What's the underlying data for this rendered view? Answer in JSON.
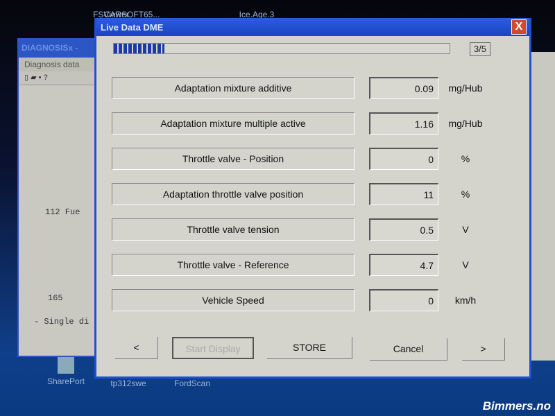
{
  "desktop": {
    "icons": [
      "FSViewer",
      "CARSOFT65...",
      "Ice.Age.3",
      "SharePort",
      "tp312swe",
      "FordScan"
    ]
  },
  "background_window": {
    "title": "DIAGNOSISx -",
    "menu": "Diagnosis data",
    "lines": [
      "112  Fue",
      "165",
      "- Single di"
    ]
  },
  "dialog": {
    "title": "Live Data DME",
    "close": "X",
    "progress_percent": 15,
    "page": "3/5",
    "rows": [
      {
        "label": "Adaptation mixture additive",
        "value": "0.09",
        "unit": "mg/Hub"
      },
      {
        "label": "Adaptation mixture multiple active",
        "value": "1.16",
        "unit": "mg/Hub"
      },
      {
        "label": "Throttle valve - Position",
        "value": "0",
        "unit": "%"
      },
      {
        "label": "Adaptation throttle valve position",
        "value": "11",
        "unit": "%"
      },
      {
        "label": "Throttle valve tension",
        "value": "0.5",
        "unit": "V"
      },
      {
        "label": "Throttle valve - Reference",
        "value": "4.7",
        "unit": "V"
      },
      {
        "label": "Vehicle Speed",
        "value": "0",
        "unit": "km/h"
      }
    ],
    "buttons": {
      "prev": "<",
      "start": "Start Display",
      "store": "STORE",
      "cancel": "Cancel",
      "next": ">"
    }
  },
  "watermark": "Bimmers.no"
}
